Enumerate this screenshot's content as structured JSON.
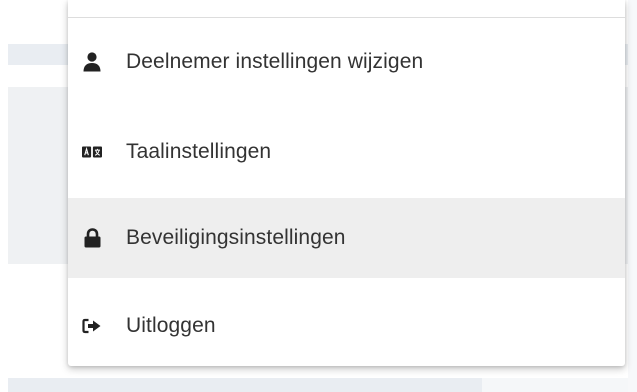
{
  "menu": {
    "items": [
      {
        "label": "Deelnemer instellingen wijzigen",
        "icon": "user-icon",
        "hovered": false
      },
      {
        "label": "Taalinstellingen",
        "icon": "language-icon",
        "hovered": false
      },
      {
        "label": "Beveiligingsinstellingen",
        "icon": "lock-icon",
        "hovered": true
      },
      {
        "label": "Uitloggen",
        "icon": "sign-out-icon",
        "hovered": false
      }
    ]
  },
  "colors": {
    "text": "#333333",
    "icon": "#222222",
    "hover_background": "#eeeeee",
    "menu_background": "#ffffff",
    "page_background": "#eff1f3"
  }
}
